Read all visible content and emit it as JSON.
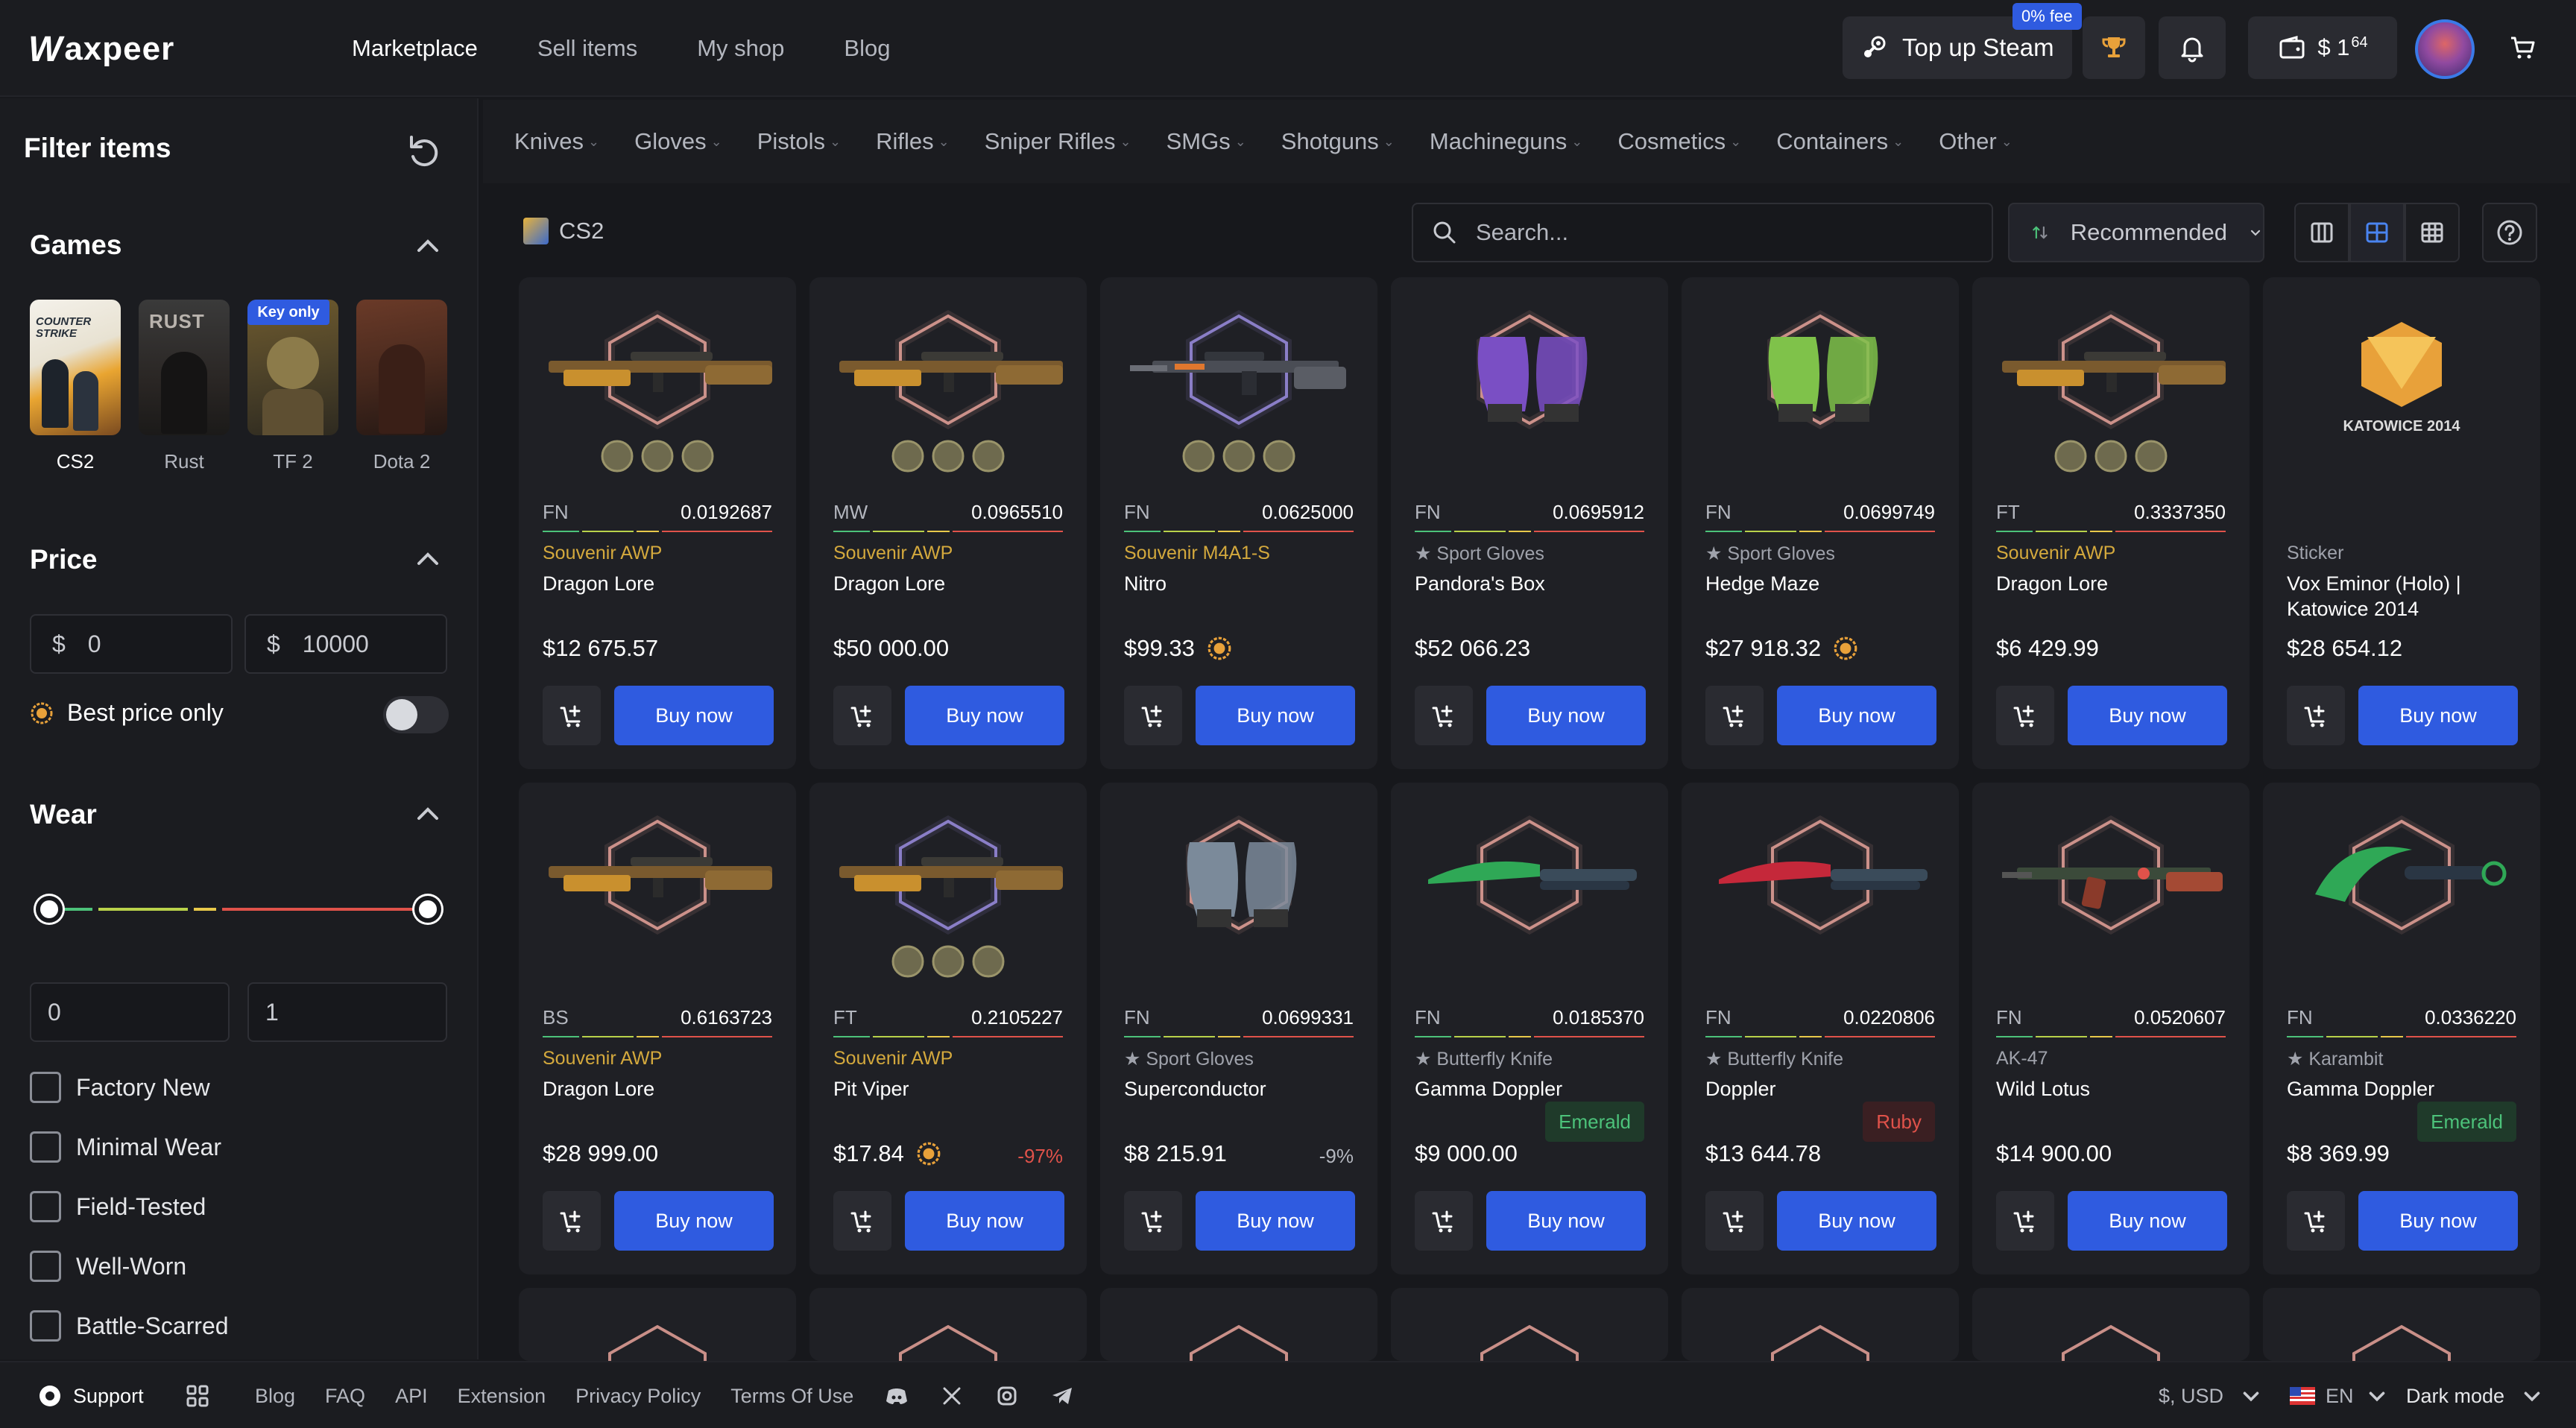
{
  "header": {
    "logo_text": "axpeer",
    "nav": [
      "Marketplace",
      "Sell items",
      "My shop",
      "Blog"
    ],
    "topup_label": "Top up Steam",
    "fee_badge": "0% fee",
    "balance_main": "$ 1",
    "balance_cents": "64"
  },
  "sidebar": {
    "title": "Filter items",
    "games_heading": "Games",
    "games": [
      {
        "label": "CS2",
        "selected": true,
        "key_only": false
      },
      {
        "label": "Rust",
        "selected": false,
        "key_only": false
      },
      {
        "label": "TF 2",
        "selected": false,
        "key_only": true
      },
      {
        "label": "Dota 2",
        "selected": false,
        "key_only": false
      }
    ],
    "key_only_badge": "Key only",
    "price_heading": "Price",
    "price_symbol": "$",
    "price_min": "0",
    "price_max": "10000",
    "best_price_label": "Best price only",
    "wear_heading": "Wear",
    "wear_min": "0",
    "wear_max": "1",
    "wear_options": [
      "Factory New",
      "Minimal Wear",
      "Field-Tested",
      "Well-Worn",
      "Battle-Scarred"
    ]
  },
  "categories": [
    "Knives",
    "Gloves",
    "Pistols",
    "Rifles",
    "Sniper Rifles",
    "SMGs",
    "Shotguns",
    "Machineguns",
    "Cosmetics",
    "Containers",
    "Other"
  ],
  "toolbar": {
    "breadcrumb": "CS2",
    "search_placeholder": "Search...",
    "sort_label": "Recommended"
  },
  "cards": [
    {
      "wear": "FN",
      "float": "0.0192687",
      "type": "Souvenir AWP",
      "name": "Dragon Lore",
      "price": "$12 675.57",
      "buy": "Buy now",
      "art": "awp",
      "ring": "#e8a39a",
      "stickers": true
    },
    {
      "wear": "MW",
      "float": "0.0965510",
      "type": "Souvenir AWP",
      "name": "Dragon Lore",
      "price": "$50 000.00",
      "buy": "Buy now",
      "art": "awp",
      "ring": "#e8a39a",
      "stickers": true
    },
    {
      "wear": "FN",
      "float": "0.0625000",
      "type": "Souvenir M4A1-S",
      "name": "Nitro",
      "price": "$99.33",
      "buy": "Buy now",
      "art": "m4",
      "ring": "#9b8ee0",
      "stickers": true,
      "badge": true
    },
    {
      "wear": "FN",
      "float": "0.0695912",
      "type": "★ Sport Gloves",
      "name": "Pandora's Box",
      "price": "$52 066.23",
      "buy": "Buy now",
      "art": "gloves",
      "ring": "#e8a39a",
      "glove": "#7a4fc4"
    },
    {
      "wear": "FN",
      "float": "0.0699749",
      "type": "★ Sport Gloves",
      "name": "Hedge Maze",
      "price": "$27 918.32",
      "buy": "Buy now",
      "art": "gloves",
      "ring": "#e8a39a",
      "glove": "#7fc24a",
      "badge": true
    },
    {
      "wear": "FT",
      "float": "0.3337350",
      "type": "Souvenir AWP",
      "name": "Dragon Lore",
      "price": "$6 429.99",
      "buy": "Buy now",
      "art": "awp",
      "ring": "#e8a39a",
      "stickers": true
    },
    {
      "wear": "",
      "float": "",
      "type": "Sticker",
      "name": "Vox Eminor (Holo) | Katowice 2014",
      "price": "$28 654.12",
      "buy": "Buy now",
      "art": "sticker",
      "sticker_text": "KATOWICE 2014"
    },
    {
      "wear": "BS",
      "float": "0.6163723",
      "type": "Souvenir AWP",
      "name": "Dragon Lore",
      "price": "$28 999.00",
      "buy": "Buy now",
      "art": "awp",
      "ring": "#e8a39a"
    },
    {
      "wear": "FT",
      "float": "0.2105227",
      "type": "Souvenir AWP",
      "name": "Pit Viper",
      "price": "$17.84",
      "buy": "Buy now",
      "art": "awp",
      "ring": "#9b8ee0",
      "stickers": true,
      "badge": true,
      "discount": "-97%",
      "disc_color": "#e0524a"
    },
    {
      "wear": "FN",
      "float": "0.0699331",
      "type": "★ Sport Gloves",
      "name": "Superconductor",
      "price": "$8 215.91",
      "buy": "Buy now",
      "art": "gloves",
      "ring": "#e8a39a",
      "glove": "#7b8a9a",
      "discount": "-9%",
      "disc_color": "#b4b7bf"
    },
    {
      "wear": "FN",
      "float": "0.0185370",
      "type": "★ Butterfly Knife",
      "name": "Gamma Doppler",
      "price": "$9 000.00",
      "buy": "Buy now",
      "art": "knife",
      "ring": "#e8a39a",
      "blade": "#2fa856",
      "phase": "Emerald",
      "phase_bg": "#1f3a2a",
      "phase_fg": "#4cc27a"
    },
    {
      "wear": "FN",
      "float": "0.0220806",
      "type": "★ Butterfly Knife",
      "name": "Doppler",
      "price": "$13 644.78",
      "buy": "Buy now",
      "art": "knife",
      "ring": "#e8a39a",
      "blade": "#c5283a",
      "phase": "Ruby",
      "phase_bg": "#3a1f22",
      "phase_fg": "#e0524a"
    },
    {
      "wear": "FN",
      "float": "0.0520607",
      "type": "AK-47",
      "name": "Wild Lotus",
      "price": "$14 900.00",
      "buy": "Buy now",
      "art": "ak",
      "ring": "#e8a39a"
    },
    {
      "wear": "FN",
      "float": "0.0336220",
      "type": "★ Karambit",
      "name": "Gamma Doppler",
      "price": "$8 369.99",
      "buy": "Buy now",
      "art": "karambit",
      "ring": "#e8a39a",
      "blade": "#2fa856",
      "phase": "Emerald",
      "phase_bg": "#1f3a2a",
      "phase_fg": "#4cc27a"
    }
  ],
  "footer": {
    "support": "Support",
    "links": [
      "Blog",
      "FAQ",
      "API",
      "Extension",
      "Privacy Policy",
      "Terms Of Use"
    ],
    "currency": "$, USD",
    "language": "EN",
    "theme": "Dark mode"
  },
  "colors": {
    "accent": "#2f5be0",
    "souvenir": "#d4a93d",
    "bg": "#17181c",
    "panel": "#1b1c20",
    "card": "#1f2025"
  }
}
